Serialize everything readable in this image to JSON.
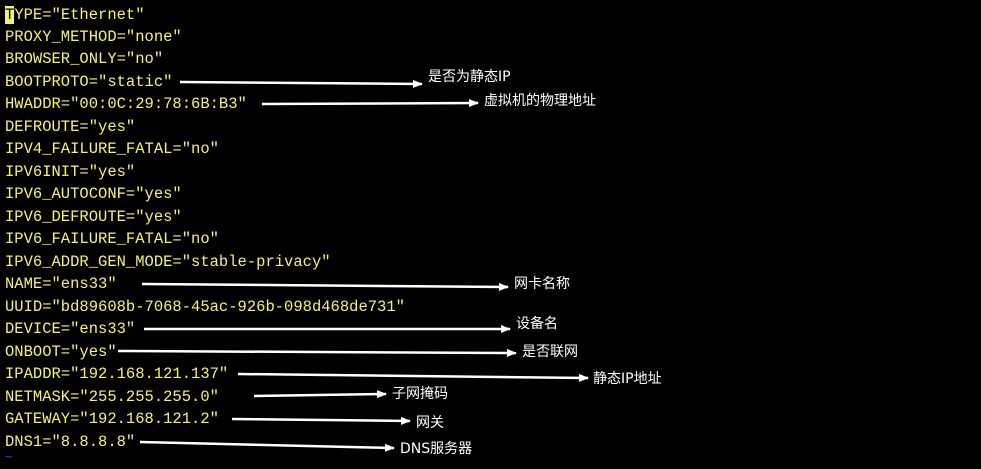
{
  "colors": {
    "background": "#000000",
    "config_text": "#f3f373",
    "annotation": "#ffffff",
    "tilde": "#3b3bff"
  },
  "editor": {
    "cursor_char": "T",
    "lines": [
      "YPE=\"Ethernet\"",
      "PROXY_METHOD=\"none\"",
      "BROWSER_ONLY=\"no\"",
      "BOOTPROTO=\"static\"",
      "HWADDR=\"00:0C:29:78:6B:B3\"",
      "DEFROUTE=\"yes\"",
      "IPV4_FAILURE_FATAL=\"no\"",
      "IPV6INIT=\"yes\"",
      "IPV6_AUTOCONF=\"yes\"",
      "IPV6_DEFROUTE=\"yes\"",
      "IPV6_FAILURE_FATAL=\"no\"",
      "IPV6_ADDR_GEN_MODE=\"stable-privacy\"",
      "NAME=\"ens33\"",
      "UUID=\"bd89608b-7068-45ac-926b-098d468de731\"",
      "DEVICE=\"ens33\"",
      "ONBOOT=\"yes\"",
      "IPADDR=\"192.168.121.137\"",
      "NETMASK=\"255.255.255.0\"",
      "GATEWAY=\"192.168.121.2\"",
      "DNS1=\"8.8.8.8\""
    ],
    "tilde": "~"
  },
  "annotations": {
    "bootproto": "是否为静态IP",
    "hwaddr": "虚拟机的物理地址",
    "name": "网卡名称",
    "device": "设备名",
    "onboot": "是否联网",
    "ipaddr": "静态IP地址",
    "netmask": "子网掩码",
    "gateway": "网关",
    "dns1": "DNS服务器"
  }
}
